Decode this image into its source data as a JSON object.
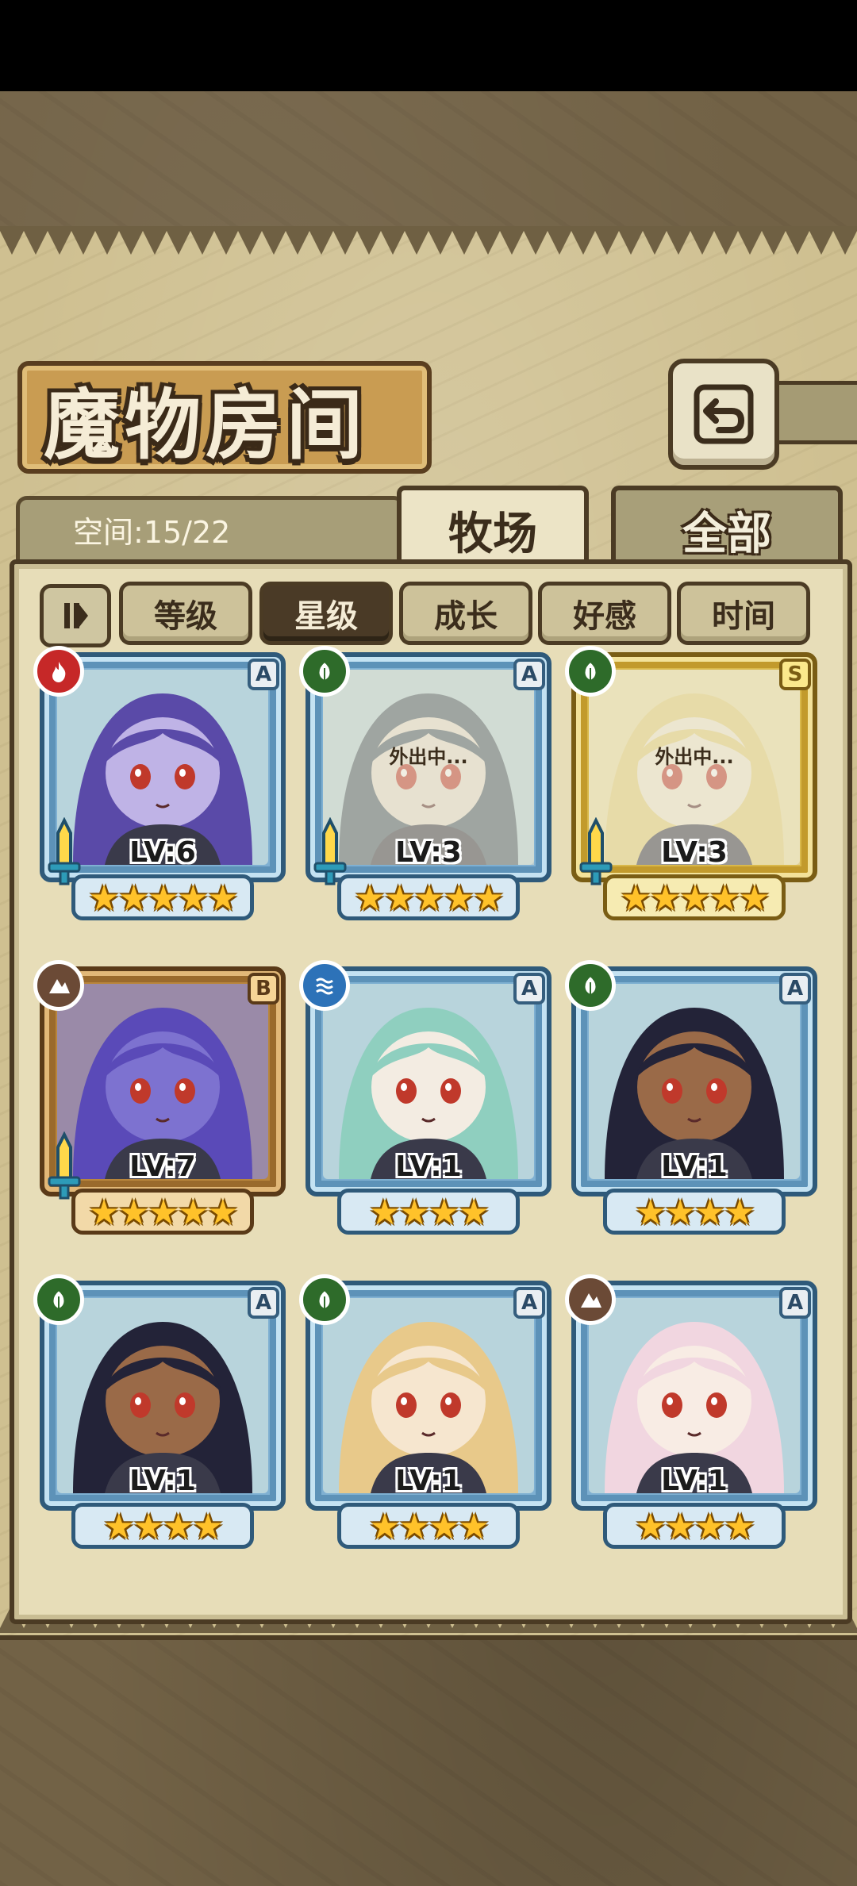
{
  "header": {
    "title": "魔物房间",
    "back_icon": "back-arrow-icon"
  },
  "space": {
    "label": "空间:15/22"
  },
  "tabs": [
    {
      "label": "牧场",
      "active": true
    },
    {
      "label": "全部",
      "active": false
    }
  ],
  "sort": {
    "toggle_icon": "sort-order-icon",
    "buttons": [
      {
        "label": "等级",
        "active": false
      },
      {
        "label": "星级",
        "active": true
      },
      {
        "label": "成长",
        "active": false
      },
      {
        "label": "好感",
        "active": false
      },
      {
        "label": "时间",
        "active": false
      }
    ]
  },
  "monsters": [
    {
      "element": "fire",
      "rank": "A",
      "level": "LV:6",
      "stars": 5,
      "frame": "blue",
      "status": "",
      "has_weapon": true,
      "hair": "#5a4aa8",
      "skin": "#bfb3e6"
    },
    {
      "element": "leaf",
      "rank": "A",
      "level": "LV:3",
      "stars": 5,
      "frame": "blue",
      "status": "外出中...",
      "has_weapon": true,
      "hair": "#4a5c6a",
      "skin": "#e8e0d2"
    },
    {
      "element": "leaf",
      "rank": "S",
      "level": "LV:3",
      "stars": 5,
      "frame": "gold",
      "status": "外出中...",
      "has_weapon": true,
      "hair": "#e9d27a",
      "skin": "#f3ead2"
    },
    {
      "element": "earth",
      "rank": "B",
      "level": "LV:7",
      "stars": 5,
      "frame": "bronze",
      "status": "",
      "has_weapon": true,
      "hair": "#5a4ab8",
      "skin": "#7d72d0"
    },
    {
      "element": "water",
      "rank": "A",
      "level": "LV:1",
      "stars": 4,
      "frame": "blue",
      "status": "",
      "has_weapon": false,
      "hair": "#8fcfbf",
      "skin": "#f3ece2"
    },
    {
      "element": "leaf",
      "rank": "A",
      "level": "LV:1",
      "stars": 4,
      "frame": "blue",
      "status": "",
      "has_weapon": false,
      "hair": "#232338",
      "skin": "#9a6a48"
    },
    {
      "element": "leaf",
      "rank": "A",
      "level": "LV:1",
      "stars": 4,
      "frame": "blue",
      "status": "",
      "has_weapon": false,
      "hair": "#232338",
      "skin": "#9a6a48"
    },
    {
      "element": "leaf",
      "rank": "A",
      "level": "LV:1",
      "stars": 4,
      "frame": "blue",
      "status": "",
      "has_weapon": false,
      "hair": "#e8c98a",
      "skin": "#f6e6cf"
    },
    {
      "element": "earth",
      "rank": "A",
      "level": "LV:1",
      "stars": 4,
      "frame": "blue",
      "status": "",
      "has_weapon": false,
      "hair": "#f1d6e0",
      "skin": "#f8ece4"
    }
  ],
  "colors": {
    "panel": "#cfc091",
    "frame_dark": "#4b3b24",
    "star": "#ffc22a"
  }
}
